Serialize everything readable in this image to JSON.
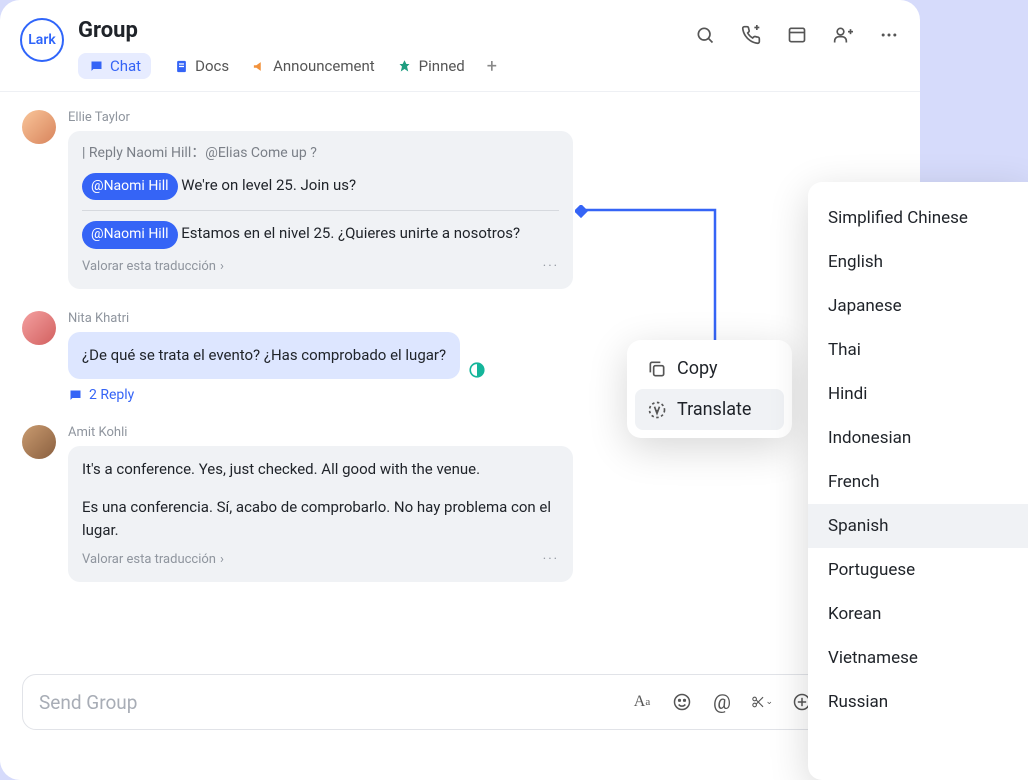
{
  "logo": "Lark",
  "title": "Group",
  "tabs": {
    "chat": "Chat",
    "docs": "Docs",
    "announcement": "Announcement",
    "pinned": "Pinned"
  },
  "messages": [
    {
      "sender": "Ellie Taylor",
      "reply_ref": "| Reply Naomi Hill：@Elias Come up ?",
      "mention": "@Naomi Hill",
      "text1": "We're on level 25. Join us?",
      "text2": "Estamos en el nivel 25. ¿Quieres unirte a nosotros?",
      "rate": "Valorar esta traducción"
    },
    {
      "sender": "Nita Khatri",
      "text": "¿De qué se trata el evento? ¿Has comprobado el lugar?",
      "replies": "2 Reply"
    },
    {
      "sender": "Amit Kohli",
      "text1": "It's a conference. Yes, just checked. All good with the venue.",
      "text2": "Es una conferencia. Sí, acabo de comprobarlo. No hay problema con el lugar.",
      "rate": "Valorar esta traducción"
    }
  ],
  "input_placeholder": "Send Group",
  "context_menu": {
    "copy": "Copy",
    "translate": "Translate"
  },
  "languages": [
    "Simplified Chinese",
    "English",
    "Japanese",
    "Thai",
    "Hindi",
    "Indonesian",
    "French",
    "Spanish",
    "Portuguese",
    "Korean",
    "Vietnamese",
    "Russian"
  ],
  "selected_language": "Spanish"
}
